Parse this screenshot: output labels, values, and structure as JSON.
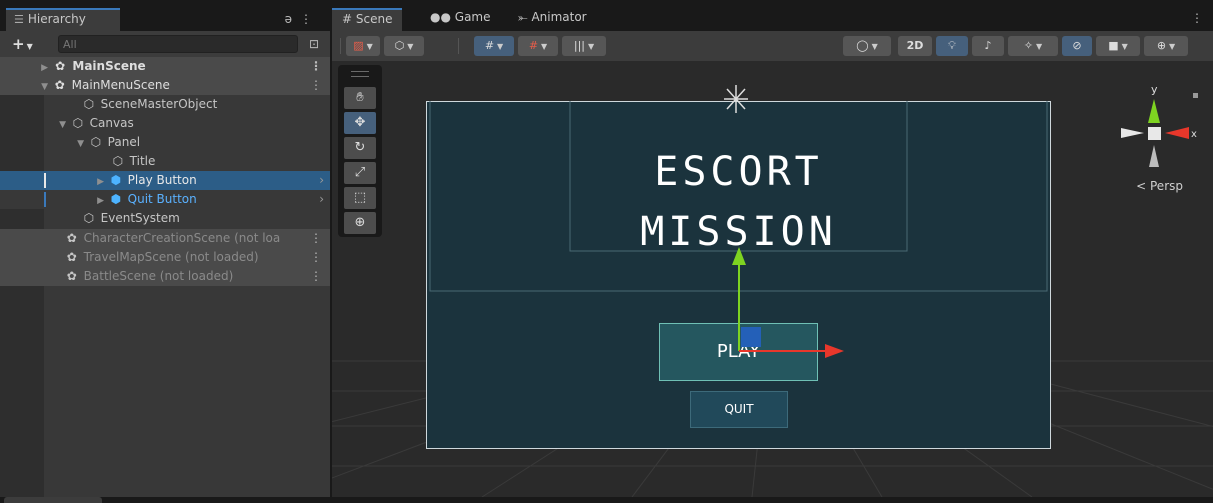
{
  "hierarchy": {
    "tab_label": "Hierarchy",
    "search_placeholder": "All",
    "rows": [
      {
        "label": "MainScene"
      },
      {
        "label": "MainMenuScene"
      },
      {
        "label": "SceneMasterObject"
      },
      {
        "label": "Canvas"
      },
      {
        "label": "Panel"
      },
      {
        "label": "Title"
      },
      {
        "label": "Play Button"
      },
      {
        "label": "Quit Button"
      },
      {
        "label": "EventSystem"
      },
      {
        "label": "CharacterCreationScene (not loa"
      },
      {
        "label": "TravelMapScene (not loaded)"
      },
      {
        "label": "BattleScene (not loaded)"
      }
    ]
  },
  "scene_view": {
    "tabs": [
      {
        "label": "Scene"
      },
      {
        "label": "Game"
      },
      {
        "label": "Animator"
      }
    ],
    "toolbar": {
      "mode_2d": "2D"
    },
    "persp_label": "Persp",
    "game_ui": {
      "title_line1": "ESCORT",
      "title_line2": "MISSION",
      "play_label": "PLAY",
      "quit_label": "QUIT"
    },
    "gizmo_axes": {
      "y": "y",
      "x": "x"
    }
  },
  "colors": {
    "selection": "#2c5d87",
    "accent": "#3a79bb",
    "canvas_bg": "#1b333d",
    "play_bg": "#25575f",
    "axis_y": "#7ed321",
    "axis_x": "#e8372b"
  },
  "icons": [
    "hierarchy-icon",
    "lock-icon",
    "plus-icon",
    "search-icon",
    "unity-scene-icon",
    "gameobject-icon",
    "prefab-icon",
    "hand-tool-icon",
    "move-tool-icon",
    "rotate-tool-icon",
    "scale-tool-icon",
    "rect-tool-icon",
    "transform-tool-icon",
    "light-icon",
    "audio-icon",
    "effects-icon",
    "visibility-icon",
    "camera-icon",
    "gizmo-icon"
  ]
}
